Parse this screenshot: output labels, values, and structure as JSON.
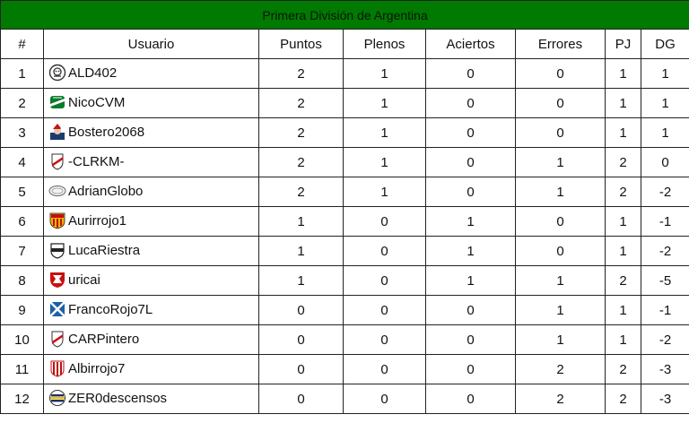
{
  "title": "Primera División de Argentina",
  "columns": {
    "pos": "#",
    "user": "Usuario",
    "puntos": "Puntos",
    "plenos": "Plenos",
    "aciertos": "Aciertos",
    "errores": "Errores",
    "pj": "PJ",
    "dg": "DG"
  },
  "rows": [
    {
      "pos": "1",
      "user": "ALD402",
      "puntos": "2",
      "plenos": "1",
      "aciertos": "0",
      "errores": "0",
      "pj": "1",
      "dg": "1",
      "icon": "skull-avatar-icon"
    },
    {
      "pos": "2",
      "user": "NicoCVM",
      "puntos": "2",
      "plenos": "1",
      "aciertos": "0",
      "errores": "0",
      "pj": "1",
      "dg": "1",
      "icon": "green-white-crest-icon"
    },
    {
      "pos": "3",
      "user": "Bostero2068",
      "puntos": "2",
      "plenos": "1",
      "aciertos": "0",
      "errores": "0",
      "pj": "1",
      "dg": "1",
      "icon": "santa-avatar-icon"
    },
    {
      "pos": "4",
      "user": "-CLRKM-",
      "puntos": "2",
      "plenos": "1",
      "aciertos": "0",
      "errores": "1",
      "pj": "2",
      "dg": "0",
      "icon": "river-plate-crest-icon"
    },
    {
      "pos": "5",
      "user": "AdrianGlobo",
      "puntos": "2",
      "plenos": "1",
      "aciertos": "0",
      "errores": "1",
      "pj": "2",
      "dg": "-2",
      "icon": "oval-badge-icon"
    },
    {
      "pos": "6",
      "user": "Aurirrojo1",
      "puntos": "1",
      "plenos": "0",
      "aciertos": "1",
      "errores": "0",
      "pj": "1",
      "dg": "-1",
      "icon": "red-yellow-crest-icon"
    },
    {
      "pos": "7",
      "user": "LucaRiestra",
      "puntos": "1",
      "plenos": "0",
      "aciertos": "1",
      "errores": "0",
      "pj": "1",
      "dg": "-2",
      "icon": "black-white-crest-icon"
    },
    {
      "pos": "8",
      "user": "uricai",
      "puntos": "1",
      "plenos": "0",
      "aciertos": "1",
      "errores": "1",
      "pj": "2",
      "dg": "-5",
      "icon": "red-shield-crest-icon"
    },
    {
      "pos": "9",
      "user": "FrancoRojo7L",
      "puntos": "0",
      "plenos": "0",
      "aciertos": "0",
      "errores": "1",
      "pj": "1",
      "dg": "-1",
      "icon": "blue-saltire-icon"
    },
    {
      "pos": "10",
      "user": "CARPintero",
      "puntos": "0",
      "plenos": "0",
      "aciertos": "0",
      "errores": "1",
      "pj": "1",
      "dg": "-2",
      "icon": "river-plate-crest-icon"
    },
    {
      "pos": "11",
      "user": "Albirrojo7",
      "puntos": "0",
      "plenos": "0",
      "aciertos": "0",
      "errores": "2",
      "pj": "2",
      "dg": "-3",
      "icon": "red-white-stripes-crest-icon"
    },
    {
      "pos": "12",
      "user": "ZER0descensos",
      "puntos": "0",
      "plenos": "0",
      "aciertos": "0",
      "errores": "2",
      "pj": "2",
      "dg": "-3",
      "icon": "striped-round-crest-icon"
    }
  ],
  "colors": {
    "title_bar": "#007a00",
    "border": "#222222",
    "background": "#ffffff"
  }
}
